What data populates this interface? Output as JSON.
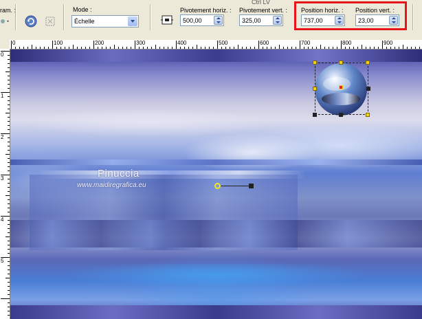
{
  "toolbar": {
    "partial_label": "ram. :",
    "top_label": "Ctrl LV",
    "mode": {
      "label": "Mode :",
      "value": "Échelle"
    },
    "pivot_h": {
      "label": "Pivotement horiz. :",
      "value": "500,00"
    },
    "pivot_v": {
      "label": "Pivotement vert. :",
      "value": "325,00"
    },
    "pos_h": {
      "label": "Position horiz. :",
      "value": "737,00"
    },
    "pos_v": {
      "label": "Position vert. :",
      "value": "23,00"
    }
  },
  "ruler": {
    "h_labels": [
      "0",
      "100",
      "200",
      "300",
      "400",
      "500",
      "600",
      "700",
      "800",
      "900"
    ],
    "v_labels": [
      "0",
      "1",
      "2",
      "3",
      "4",
      "5"
    ]
  },
  "watermark": {
    "name": "Pinuccia",
    "url": "www.maidiregrafica.eu"
  },
  "colors": {
    "highlight": "#e8141b",
    "handle": "#f3d11a",
    "toolbar_bg": "#ece9d8"
  }
}
